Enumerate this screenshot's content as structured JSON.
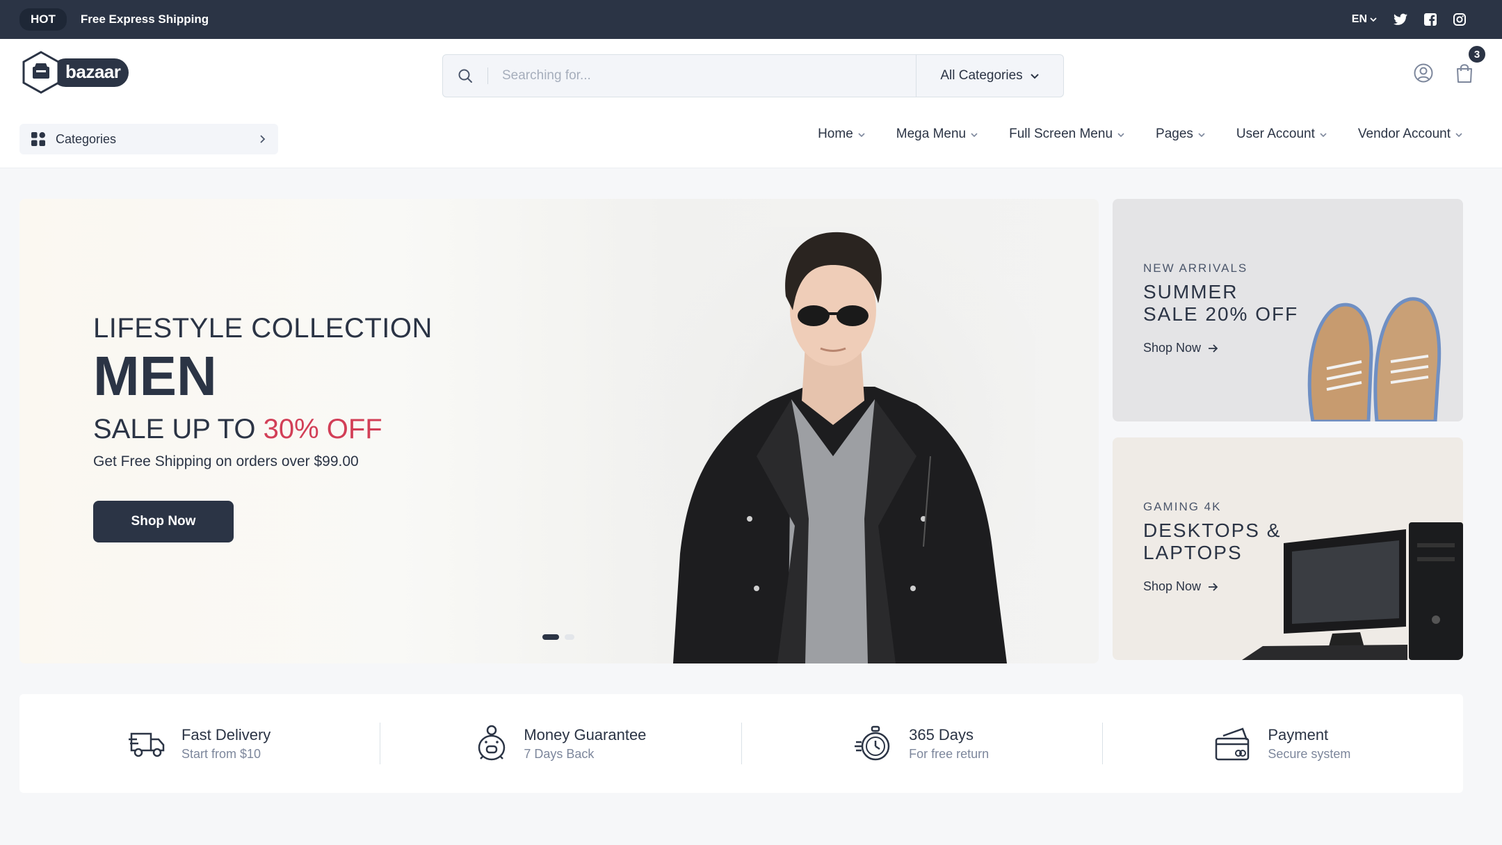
{
  "topbar": {
    "badge": "HOT",
    "message": "Free Express Shipping",
    "language": "EN",
    "social": [
      "twitter-icon",
      "facebook-icon",
      "instagram-icon"
    ]
  },
  "header": {
    "logo_text": "bazaar",
    "search": {
      "placeholder": "Searching for..."
    },
    "category_select": "All Categories",
    "cart_count": "3"
  },
  "nav": {
    "categories_label": "Categories",
    "items": [
      {
        "label": "Home"
      },
      {
        "label": "Mega Menu"
      },
      {
        "label": "Full Screen Menu"
      },
      {
        "label": "Pages"
      },
      {
        "label": "User Account"
      },
      {
        "label": "Vendor Account"
      }
    ]
  },
  "hero": {
    "subtitle": "LIFESTYLE COLLECTION",
    "title": "MEN",
    "sale_prefix": "SALE UP TO ",
    "sale_highlight": "30% OFF",
    "description": "Get Free Shipping on orders over $99.00",
    "button": "Shop Now",
    "slides_total": 2,
    "slide_active": 1
  },
  "banners": [
    {
      "eyebrow": "NEW ARRIVALS",
      "title_line1": "SUMMER",
      "title_line2": "SALE 20% OFF",
      "link": "Shop Now"
    },
    {
      "eyebrow": "GAMING 4K",
      "title_line1": "DESKTOPS &",
      "title_line2": "LAPTOPS",
      "link": "Shop Now"
    }
  ],
  "services": [
    {
      "title": "Fast Delivery",
      "subtitle": "Start from $10",
      "icon": "truck-icon"
    },
    {
      "title": "Money Guarantee",
      "subtitle": "7 Days Back",
      "icon": "piggy-bank-icon"
    },
    {
      "title": "365 Days",
      "subtitle": "For free return",
      "icon": "stopwatch-icon"
    },
    {
      "title": "Payment",
      "subtitle": "Secure system",
      "icon": "credit-card-icon"
    }
  ],
  "colors": {
    "primary": "#2b3445",
    "accent": "#d23f57",
    "background": "#f6f7f9"
  }
}
